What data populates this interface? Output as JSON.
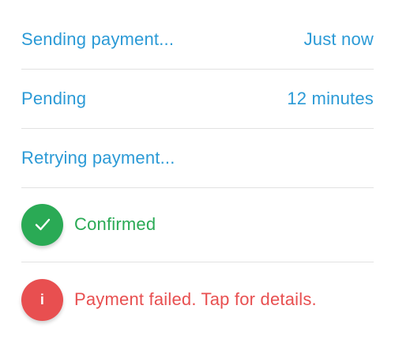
{
  "rows": [
    {
      "label": "Sending payment...",
      "meta": "Just now",
      "state": "sending"
    },
    {
      "label": "Pending",
      "meta": "12 minutes",
      "state": "pending"
    },
    {
      "label": "Retrying payment...",
      "state": "retrying"
    },
    {
      "label": "Confirmed",
      "icon": "checkmark-icon",
      "state": "confirmed"
    },
    {
      "label": "Payment failed. Tap for details.",
      "icon": "info-icon",
      "icon_glyph": "i",
      "state": "failed"
    }
  ],
  "colors": {
    "in_progress": "#2b9ad6",
    "success": "#2aaa55",
    "error": "#e84f50",
    "divider": "#e2e2e2"
  }
}
